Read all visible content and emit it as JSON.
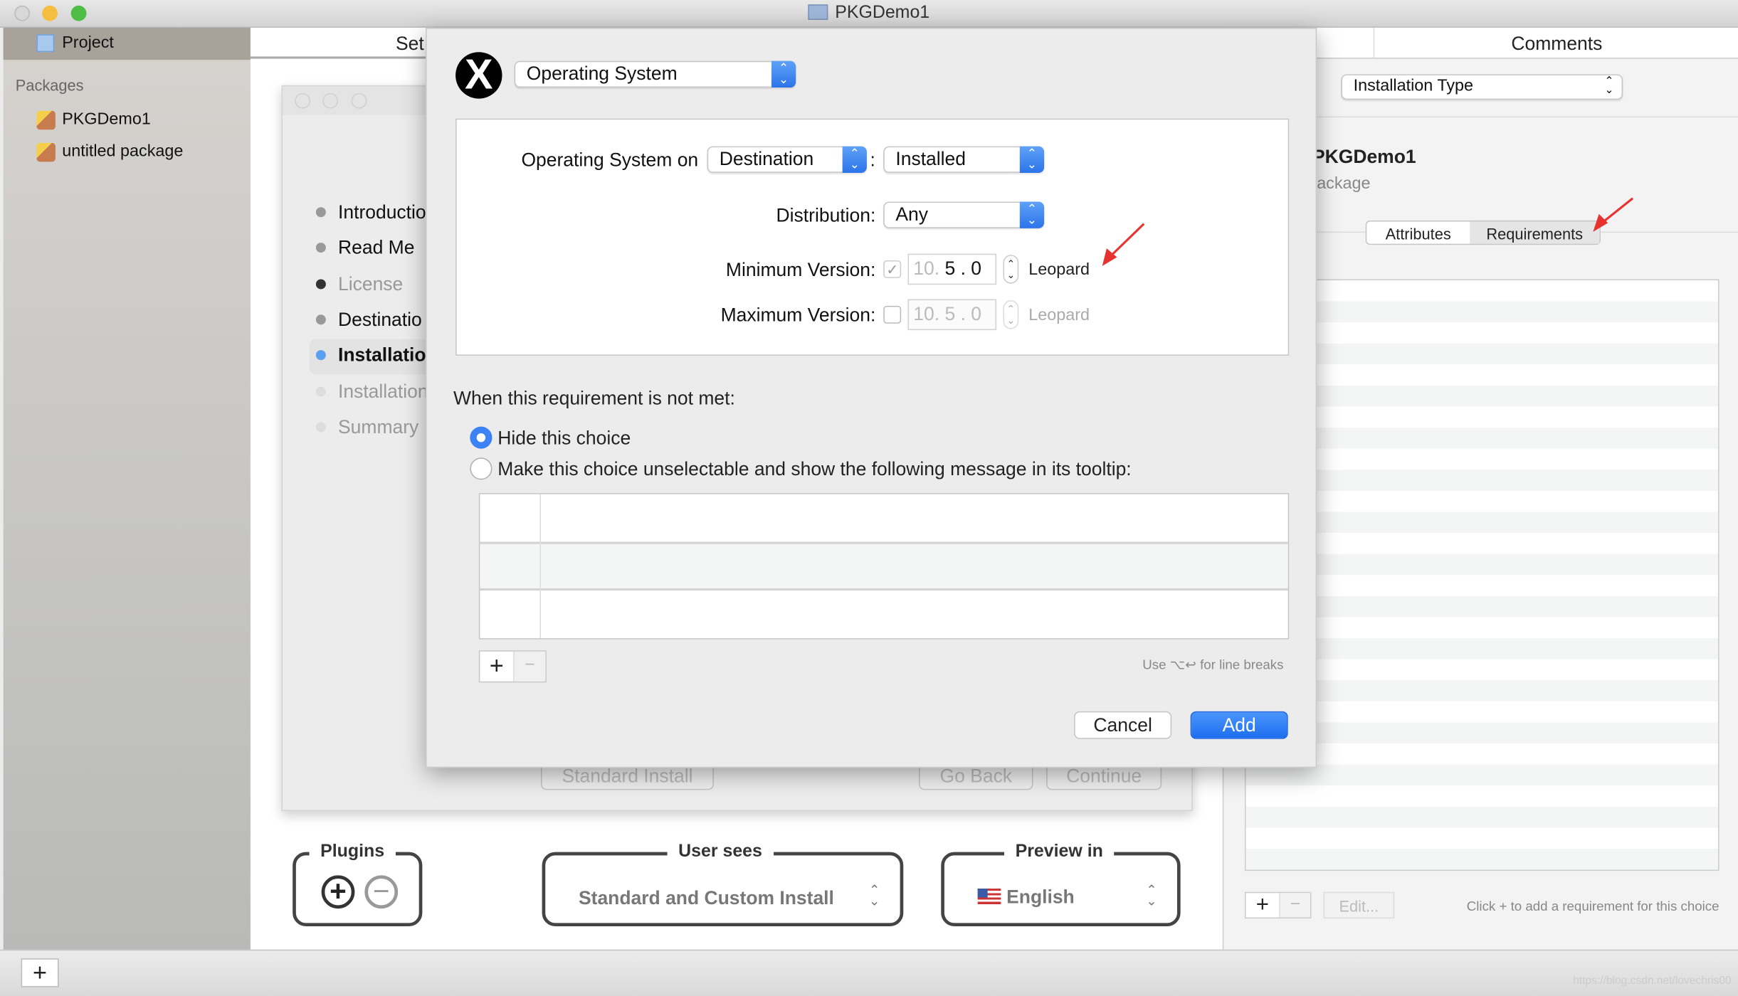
{
  "window": {
    "title": "PKGDemo1"
  },
  "sidebar": {
    "project_label": "Project",
    "packages_header": "Packages",
    "packages": [
      {
        "label": "PKGDemo1"
      },
      {
        "label": "untitled package"
      }
    ],
    "add_label": "+"
  },
  "center": {
    "tab_label": "Set",
    "steps": [
      {
        "label": "Introductio"
      },
      {
        "label": "Read Me"
      },
      {
        "label": "License"
      },
      {
        "label": "Destinatio"
      },
      {
        "label": "Installatio"
      },
      {
        "label": "Installation"
      },
      {
        "label": "Summary"
      }
    ],
    "preview_buttons": {
      "standard_install": "Standard Install",
      "go_back": "Go Back",
      "continue": "Continue"
    },
    "plugins": {
      "label": "Plugins"
    },
    "user_sees": {
      "label": "User sees",
      "value": "Standard and Custom Install"
    },
    "preview_in": {
      "label": "Preview in",
      "value": "English"
    }
  },
  "right": {
    "tab_comments": "Comments",
    "popup_value": "Installation Type",
    "name": "PKGDemo1",
    "subtitle": "ackage",
    "tabs": [
      {
        "label": "Attributes"
      },
      {
        "label": "Requirements",
        "active": true
      }
    ],
    "edit_label": "Edit...",
    "hint": "Click + to add a requirement for this choice"
  },
  "sheet": {
    "type_value": "Operating System",
    "os_on_label": "Operating System on",
    "os_on_value": "Destination",
    "colon": ":",
    "os_state_value": "Installed",
    "distribution_label": "Distribution:",
    "distribution_value": "Any",
    "min_label": "Minimum Version:",
    "min_checked": true,
    "min_major": "10.",
    "min_minor": "5",
    "min_patch": "0",
    "min_name": "Leopard",
    "max_label": "Maximum Version:",
    "max_checked": false,
    "max_major": "10.",
    "max_minor": "5",
    "max_patch": "0",
    "max_name": "Leopard",
    "not_met_label": "When this requirement is not met:",
    "options": [
      {
        "label": "Hide this choice",
        "selected": true
      },
      {
        "label": "Make this choice unselectable and show the following message in its tooltip:",
        "selected": false
      }
    ],
    "line_break_hint": "Use ⌥↩ for line breaks",
    "cancel": "Cancel",
    "add": "Add"
  },
  "watermark": "https://blog.csdn.net/lovechris00",
  "colors": {
    "accent": "#2c74ea",
    "annotation_arrow": "#e8322f"
  }
}
